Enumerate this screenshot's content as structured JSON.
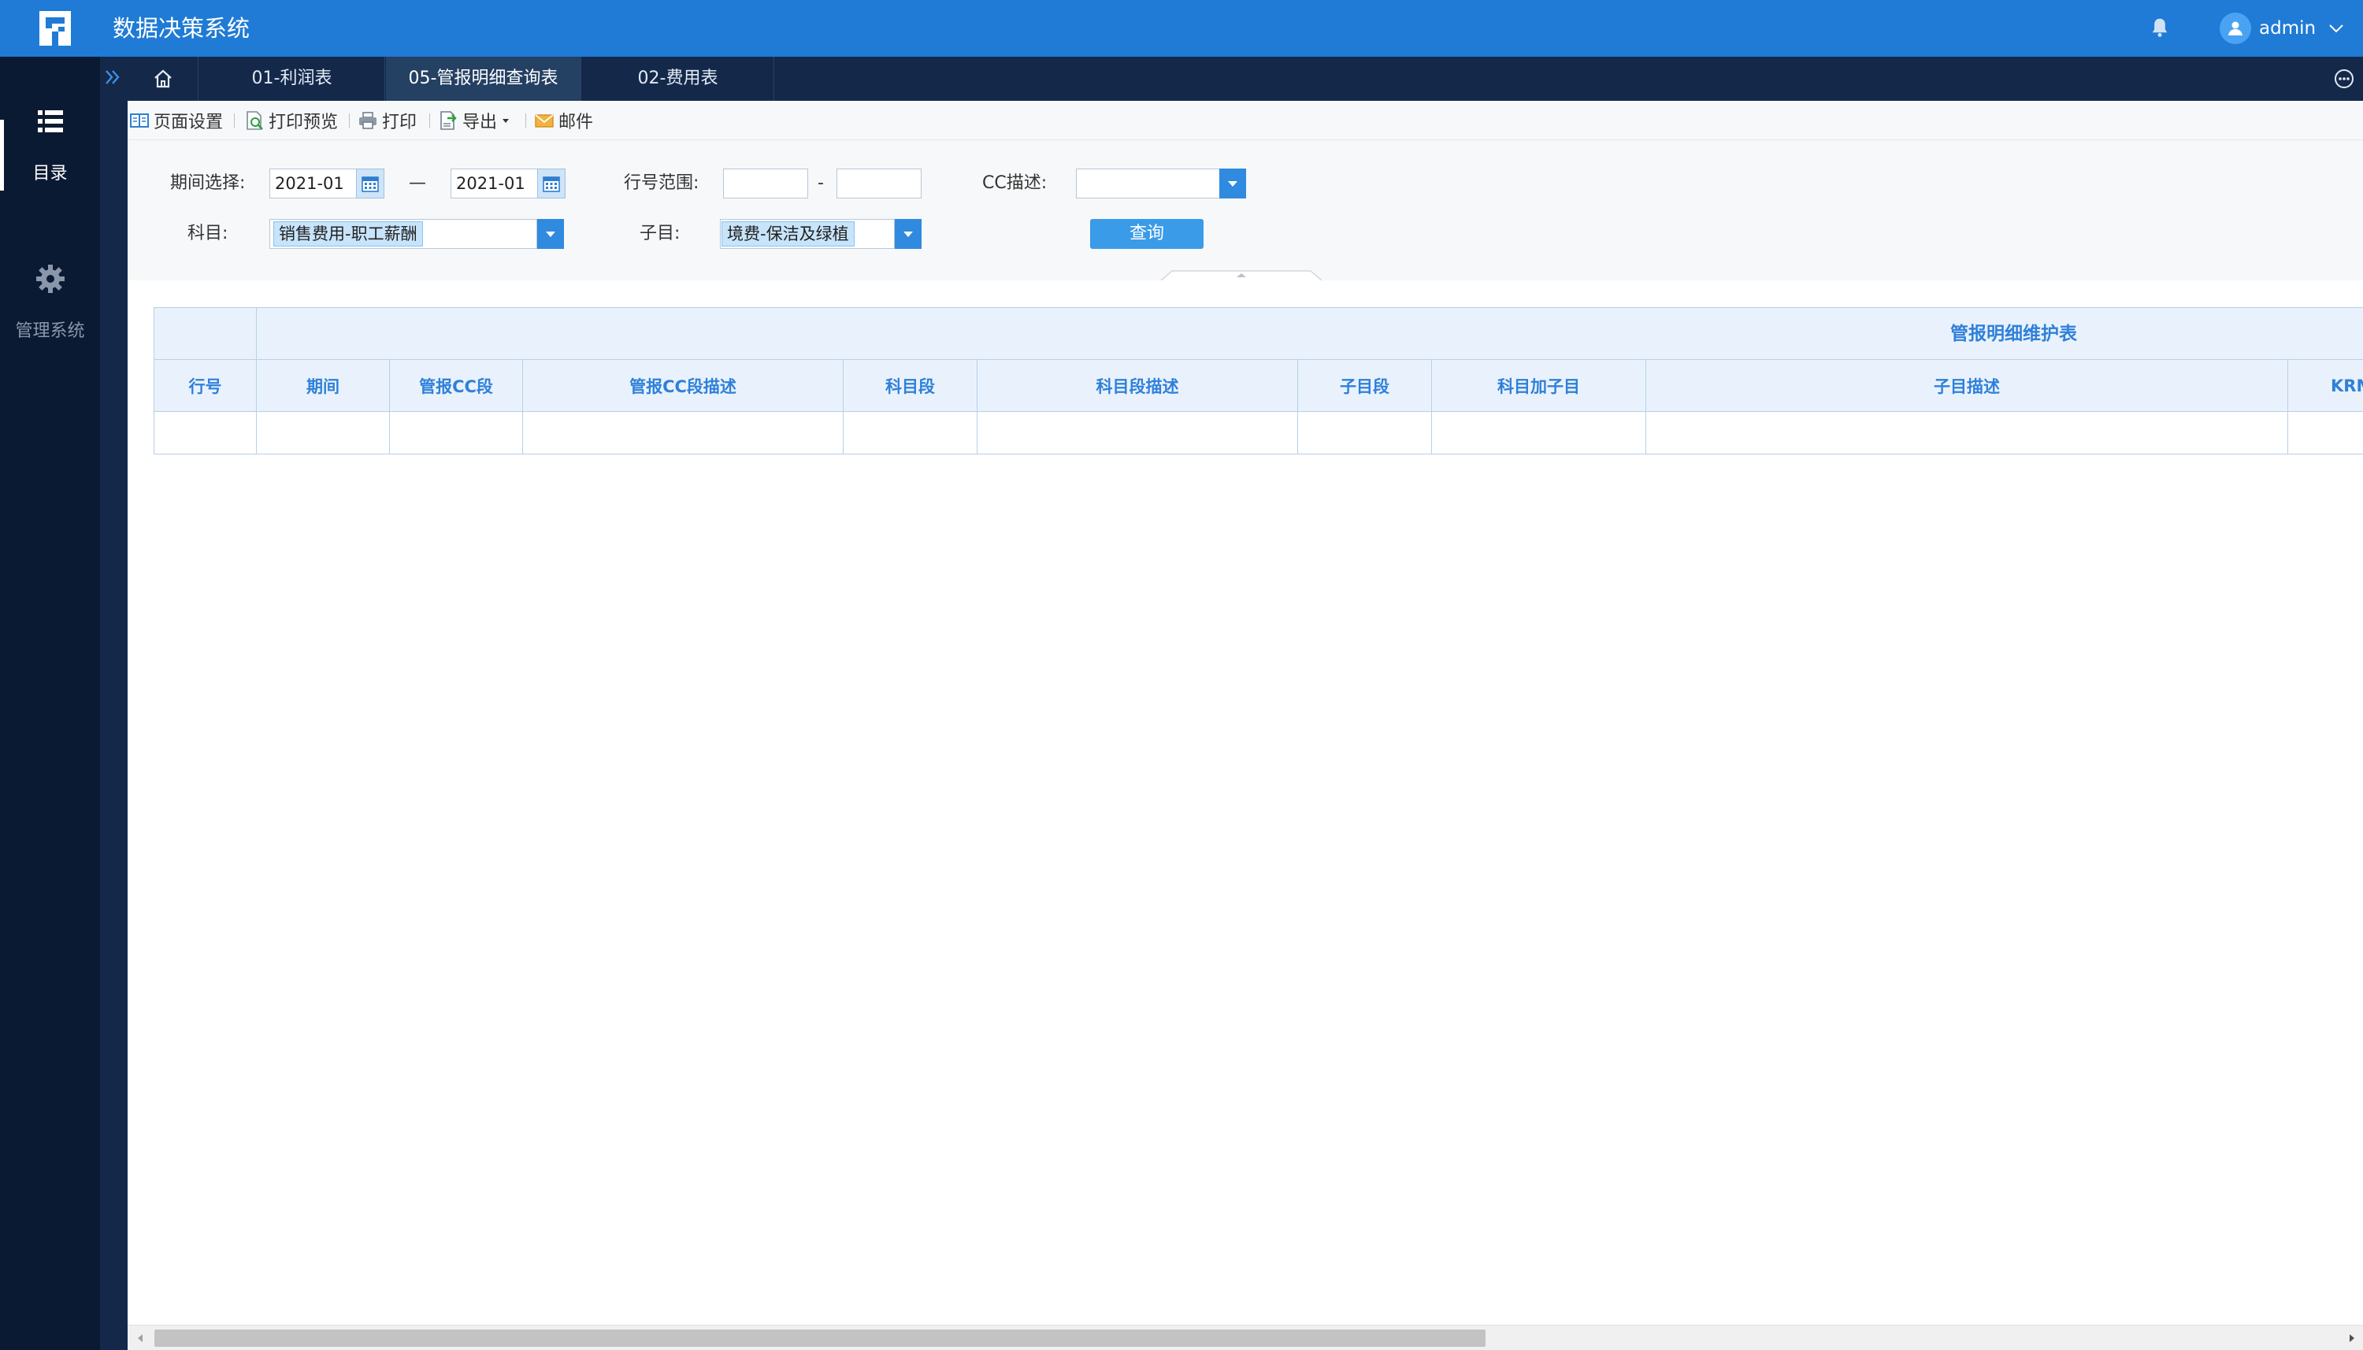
{
  "header": {
    "app_title": "数据决策系统",
    "username": "admin",
    "brand_color": "#1f7bd5"
  },
  "sidebar": {
    "items": [
      {
        "label": "目录",
        "icon": "list-icon",
        "active": true
      },
      {
        "label": "管理系统",
        "icon": "gear-icon",
        "active": false
      }
    ]
  },
  "tabs": [
    {
      "label": "01-利润表",
      "active": false
    },
    {
      "label": "05-管报明细查询表",
      "active": true
    },
    {
      "label": "02-费用表",
      "active": false
    }
  ],
  "toolbar": {
    "page_setup": "页面设置",
    "print_preview": "打印预览",
    "print": "打印",
    "export": "导出",
    "mail": "邮件"
  },
  "filters": {
    "period_label": "期间选择:",
    "period_start": "2021-01",
    "period_dash": "—",
    "period_end": "2021-01",
    "row_range_label": "行号范围:",
    "row_range_from": "",
    "row_range_dash": "-",
    "row_range_to": "",
    "cc_label": "CC描述:",
    "cc_value": "",
    "subject_label": "科目:",
    "subject_value": "销售费用-职工薪酬",
    "subitem_label": "子目:",
    "subitem_value": "境费-保洁及绿植",
    "query_button": "查询"
  },
  "table": {
    "group_header": "管报明细维护表",
    "columns": [
      "行号",
      "期间",
      "管报CC段",
      "管报CC段描述",
      "科目段",
      "科目段描述",
      "子目段",
      "科目加子目",
      "子目描述",
      "KRM"
    ],
    "rows": []
  }
}
